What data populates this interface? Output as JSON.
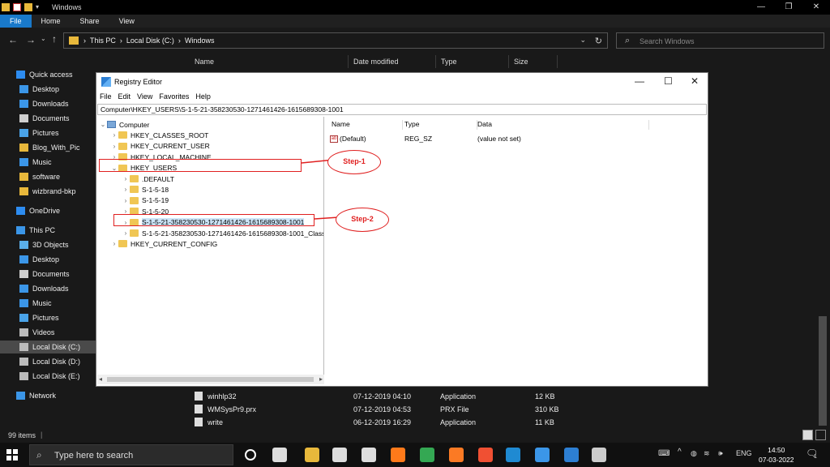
{
  "explorer": {
    "title": "Windows",
    "ribbon_tabs": [
      "File",
      "Home",
      "Share",
      "View"
    ],
    "breadcrumb": [
      "This PC",
      "Local Disk (C:)",
      "Windows"
    ],
    "search_placeholder": "Search Windows",
    "columns": [
      "Name",
      "Date modified",
      "Type",
      "Size"
    ],
    "sidebar": [
      {
        "label": "Quick access",
        "icon": "star-icon",
        "color": "#2d8cf0"
      },
      {
        "label": "Desktop",
        "icon": "desktop-icon",
        "color": "#3b96e8"
      },
      {
        "label": "Downloads",
        "icon": "download-icon",
        "color": "#3b96e8"
      },
      {
        "label": "Documents",
        "icon": "document-icon",
        "color": "#cfcfcf"
      },
      {
        "label": "Pictures",
        "icon": "picture-icon",
        "color": "#4aa3e8"
      },
      {
        "label": "Blog_With_Pic",
        "icon": "folder-icon",
        "color": "#e8b83b"
      },
      {
        "label": "Music",
        "icon": "music-icon",
        "color": "#3b96e8"
      },
      {
        "label": "software",
        "icon": "folder-icon",
        "color": "#e8b83b"
      },
      {
        "label": "wizbrand-bkp",
        "icon": "folder-icon",
        "color": "#e8b83b"
      },
      {
        "label": "OneDrive",
        "icon": "cloud-icon",
        "color": "#2d8cf0"
      },
      {
        "label": "This PC",
        "icon": "computer-icon",
        "color": "#3b96e8"
      },
      {
        "label": "3D Objects",
        "icon": "cube-icon",
        "color": "#5aaee8"
      },
      {
        "label": "Desktop",
        "icon": "desktop-icon",
        "color": "#3b96e8"
      },
      {
        "label": "Documents",
        "icon": "document-icon",
        "color": "#cfcfcf"
      },
      {
        "label": "Downloads",
        "icon": "download-icon",
        "color": "#3b96e8"
      },
      {
        "label": "Music",
        "icon": "music-icon",
        "color": "#3b96e8"
      },
      {
        "label": "Pictures",
        "icon": "picture-icon",
        "color": "#4aa3e8"
      },
      {
        "label": "Videos",
        "icon": "video-icon",
        "color": "#bbbbbb"
      },
      {
        "label": "Local Disk (C:)",
        "icon": "drive-icon",
        "color": "#bbbbbb",
        "selected": true
      },
      {
        "label": "Local Disk (D:)",
        "icon": "drive-icon",
        "color": "#bbbbbb"
      },
      {
        "label": "Local Disk (E:)",
        "icon": "drive-icon",
        "color": "#bbbbbb"
      },
      {
        "label": "Network",
        "icon": "network-icon",
        "color": "#3b96e8"
      }
    ],
    "files": [
      {
        "name": "winhlp32",
        "date": "07-12-2019 04:10",
        "type": "Application",
        "size": "12 KB"
      },
      {
        "name": "WMSysPr9.prx",
        "date": "07-12-2019 04:53",
        "type": "PRX File",
        "size": "310 KB"
      },
      {
        "name": "write",
        "date": "06-12-2019 16:29",
        "type": "Application",
        "size": "11 KB"
      }
    ],
    "status": "99 items"
  },
  "regedit": {
    "title": "Registry Editor",
    "menu": [
      "File",
      "Edit",
      "View",
      "Favorites",
      "Help"
    ],
    "path": "Computer\\HKEY_USERS\\S-1-5-21-358230530-1271461426-1615689308-1001",
    "tree": [
      {
        "label": "Computer",
        "level": 0,
        "arrow": "⌄",
        "kind": "pc"
      },
      {
        "label": "HKEY_CLASSES_ROOT",
        "level": 1,
        "arrow": "›"
      },
      {
        "label": "HKEY_CURRENT_USER",
        "level": 1,
        "arrow": "›"
      },
      {
        "label": "HKEY_LOCAL_MACHINE",
        "level": 1,
        "arrow": "›"
      },
      {
        "label": "HKEY_USERS",
        "level": 1,
        "arrow": "⌄"
      },
      {
        "label": ".DEFAULT",
        "level": 2,
        "arrow": "›"
      },
      {
        "label": "S-1-5-18",
        "level": 2,
        "arrow": "›"
      },
      {
        "label": "S-1-5-19",
        "level": 2,
        "arrow": "›"
      },
      {
        "label": "S-1-5-20",
        "level": 2,
        "arrow": "›"
      },
      {
        "label": "S-1-5-21-358230530-1271461426-1615689308-1001",
        "level": 2,
        "arrow": "›",
        "selected": true
      },
      {
        "label": "S-1-5-21-358230530-1271461426-1615689308-1001_Classes",
        "level": 2,
        "arrow": "›"
      },
      {
        "label": "HKEY_CURRENT_CONFIG",
        "level": 1,
        "arrow": "›"
      }
    ],
    "value_columns": [
      "Name",
      "Type",
      "Data"
    ],
    "values": [
      {
        "name": "(Default)",
        "type": "REG_SZ",
        "data": "(value not set)"
      }
    ]
  },
  "annotations": {
    "step1": "Step-1",
    "step2": "Step-2",
    "color": "#e02020"
  },
  "taskbar": {
    "search_placeholder": "Type here to search",
    "language": "ENG",
    "time": "14:50",
    "date": "07-03-2022",
    "notification_count": "1",
    "apps": [
      {
        "icon": "cortana-icon",
        "color": "#ffffff"
      },
      {
        "icon": "task-view-icon",
        "color": "#dddddd"
      },
      {
        "icon": "file-explorer-icon",
        "color": "#e8b83b"
      },
      {
        "icon": "store-icon",
        "color": "#dddddd"
      },
      {
        "icon": "mail-icon",
        "color": "#dddddd"
      },
      {
        "icon": "firefox-icon",
        "color": "#ff7a1a"
      },
      {
        "icon": "chrome-icon",
        "color": "#34a853"
      },
      {
        "icon": "xampp-icon",
        "color": "#fb7a24"
      },
      {
        "icon": "git-icon",
        "color": "#f05033"
      },
      {
        "icon": "vscode-icon",
        "color": "#1f8ad2"
      },
      {
        "icon": "remote-desktop-icon",
        "color": "#3b96e8"
      },
      {
        "icon": "regedit-icon",
        "color": "#2d7fd3"
      },
      {
        "icon": "snipping-icon",
        "color": "#cccccc"
      }
    ]
  }
}
